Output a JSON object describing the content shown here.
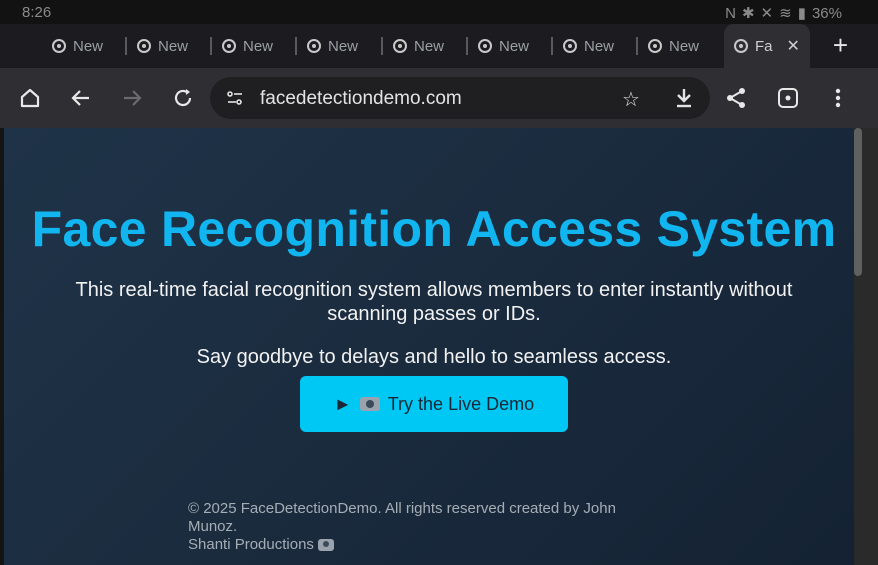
{
  "status_bar": {
    "time": "8:26",
    "battery": "36%"
  },
  "tabs": [
    {
      "label": "New"
    },
    {
      "label": "New"
    },
    {
      "label": "New"
    },
    {
      "label": "New"
    },
    {
      "label": "New"
    },
    {
      "label": "New"
    },
    {
      "label": "New"
    },
    {
      "label": "New"
    },
    {
      "label": "Fa",
      "active": true
    }
  ],
  "toolbar": {
    "url": "facedetectiondemo.com"
  },
  "page": {
    "title": "Face Recognition Access System",
    "description": "This real-time facial recognition system allows members to enter instantly without scanning passes or IDs.",
    "tagline": "Say goodbye to delays and hello to seamless access.",
    "cta": {
      "play": "►",
      "label": "Try the Live Demo"
    },
    "footer": {
      "line1": "© 2025 FaceDetectionDemo. All rights reserved created by John Munoz.",
      "line2": "Shanti Productions"
    }
  },
  "colors": {
    "accent": "#11b6f0",
    "button": "#00c8f5"
  }
}
